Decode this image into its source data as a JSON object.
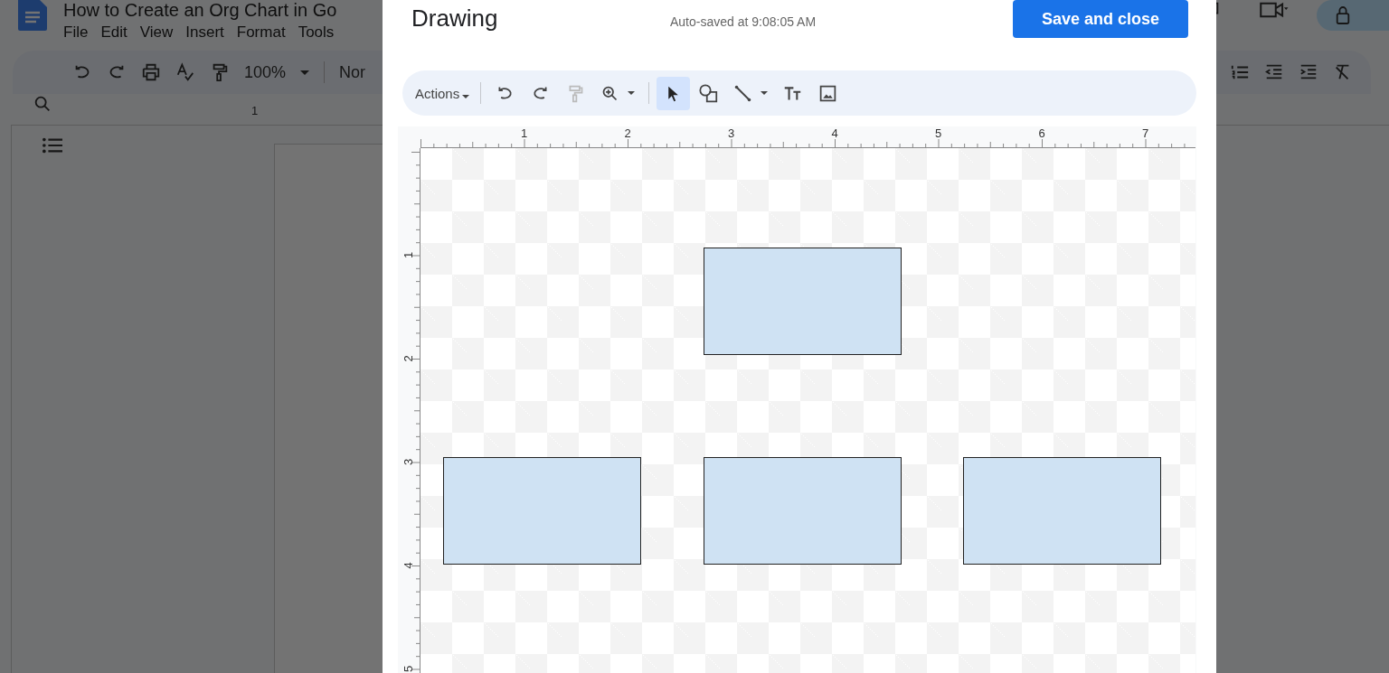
{
  "document": {
    "title": "How to Create an Org Chart in Go",
    "menu": [
      "File",
      "Edit",
      "View",
      "Insert",
      "Format",
      "Tools"
    ],
    "zoom": "100%",
    "style": "Nor",
    "ruler_label": "1"
  },
  "drawing_dialog": {
    "title": "Drawing",
    "autosave": "Auto-saved at 9:08:05 AM",
    "save_button": "Save and close",
    "actions_menu": "Actions",
    "tools": [
      {
        "kind": "undo",
        "selected": false,
        "menu": false
      },
      {
        "kind": "redo",
        "selected": false,
        "menu": false
      },
      {
        "kind": "paint-format",
        "selected": false,
        "menu": false
      },
      {
        "kind": "zoom",
        "selected": false,
        "menu": true
      },
      {
        "kind": "select",
        "selected": true,
        "menu": false
      },
      {
        "kind": "shape",
        "selected": false,
        "menu": false
      },
      {
        "kind": "line",
        "selected": false,
        "menu": true
      },
      {
        "kind": "text",
        "selected": false,
        "menu": false
      },
      {
        "kind": "image",
        "selected": false,
        "menu": false
      }
    ],
    "ruler_horizontal": [
      "1",
      "2",
      "3",
      "4",
      "5",
      "6",
      "7"
    ],
    "ruler_vertical": [
      "1",
      "2",
      "3",
      "4",
      "5"
    ],
    "shapes": [
      {
        "kind": "rectangle"
      },
      {
        "kind": "rectangle"
      },
      {
        "kind": "rectangle"
      },
      {
        "kind": "rectangle"
      }
    ]
  }
}
